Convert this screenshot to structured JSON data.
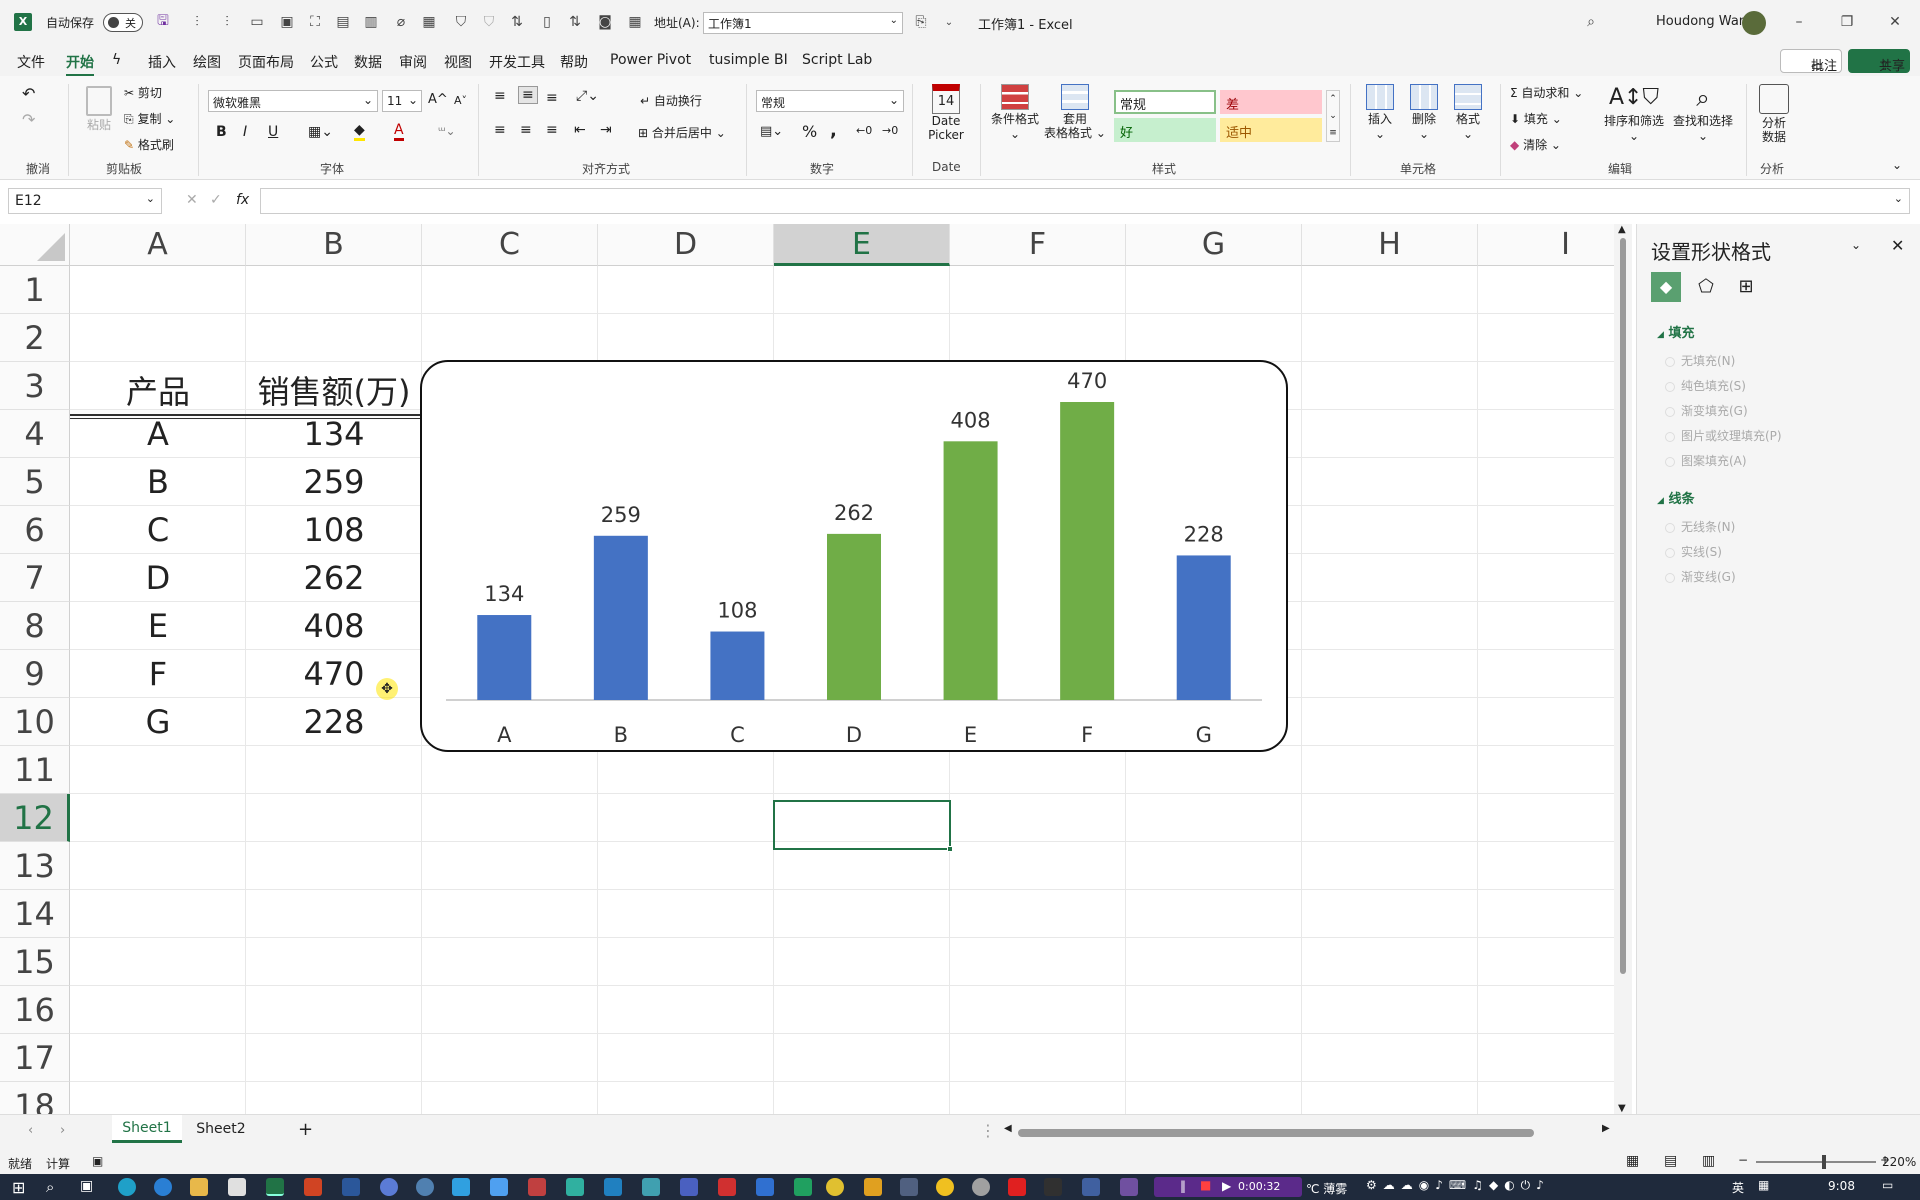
{
  "titlebar": {
    "autosave_label": "自动保存",
    "autosave_state": "关",
    "address_label": "地址(A):",
    "address_value": "工作簿1",
    "title": "工作簿1 - Excel",
    "user": "Houdong Wang"
  },
  "menu": {
    "items": [
      "文件",
      "开始",
      "插入",
      "绘图",
      "页面布局",
      "公式",
      "数据",
      "审阅",
      "视图",
      "开发工具",
      "帮助",
      "Power Pivot",
      "tusimple BI",
      "Script Lab"
    ],
    "comment_btn": "批注",
    "share_btn": "共享"
  },
  "ribbon": {
    "undo": "撤消",
    "paste": "粘贴",
    "cut": "剪切",
    "copy": "复制",
    "format_painter": "格式刷",
    "clipboard": "剪贴板",
    "font_name": "微软雅黑",
    "font_size": "11",
    "bold": "B",
    "italic": "I",
    "underline": "U",
    "font_group": "字体",
    "wrap": "自动换行",
    "merge": "合并后居中",
    "align_group": "对齐方式",
    "num_format": "常规",
    "percent": "%",
    "comma": ",",
    "number_group": "数字",
    "date_picker": "Date Picker",
    "date_group": "Date",
    "date_icon": "14",
    "cond_format": "条件格式",
    "table_format1": "套用",
    "table_format2": "表格格式",
    "style_normal": "常规",
    "style_bad": "差",
    "style_good": "好",
    "style_neutral": "适中",
    "style_group": "样式",
    "insert": "插入",
    "delete": "删除",
    "format": "格式",
    "cells_group": "单元格",
    "autosum": "自动求和",
    "fill": "填充",
    "clear": "清除",
    "sort_filter": "排序和筛选",
    "find_select": "查找和选择",
    "edit_group": "编辑",
    "analyze1": "分析",
    "analyze2": "数据",
    "analyze_group": "分析"
  },
  "formula_bar": {
    "name_box": "E12",
    "fx": "fx",
    "formula": ""
  },
  "sheet": {
    "columns": [
      "A",
      "B",
      "C",
      "D",
      "E",
      "F",
      "G",
      "H",
      "I"
    ],
    "rows": [
      "1",
      "2",
      "3",
      "4",
      "5",
      "6",
      "7",
      "8",
      "9",
      "10",
      "11",
      "12",
      "13",
      "14",
      "15",
      "16",
      "17",
      "18"
    ],
    "header_product": "产品",
    "header_sales": "销售额(万)",
    "data": [
      {
        "p": "A",
        "v": "134"
      },
      {
        "p": "B",
        "v": "259"
      },
      {
        "p": "C",
        "v": "108"
      },
      {
        "p": "D",
        "v": "262"
      },
      {
        "p": "E",
        "v": "408"
      },
      {
        "p": "F",
        "v": "470"
      },
      {
        "p": "G",
        "v": "228"
      }
    ],
    "selected_cell": "E12"
  },
  "chart_data": {
    "type": "bar",
    "categories": [
      "A",
      "B",
      "C",
      "D",
      "E",
      "F",
      "G"
    ],
    "values": [
      134,
      259,
      108,
      262,
      408,
      470,
      228
    ],
    "title": "",
    "xlabel": "",
    "ylabel": "",
    "ylim": [
      0,
      470
    ],
    "data_labels": true,
    "grid": false,
    "legend": "none",
    "colors": {
      "below_avg": "#4472c4",
      "above_avg": "#70ad47"
    },
    "bar_colors": [
      "#4472c4",
      "#4472c4",
      "#4472c4",
      "#70ad47",
      "#70ad47",
      "#70ad47",
      "#4472c4"
    ]
  },
  "pane": {
    "title": "设置形状格式",
    "fill_section": "填充",
    "fill_options": [
      "无填充(N)",
      "纯色填充(S)",
      "渐变填充(G)",
      "图片或纹理填充(P)",
      "图案填充(A)"
    ],
    "line_section": "线条",
    "line_options": [
      "无线条(N)",
      "实线(S)",
      "渐变线(G)"
    ]
  },
  "sheets": {
    "tabs": [
      "Sheet1",
      "Sheet2"
    ],
    "add": "+"
  },
  "status": {
    "ready": "就绪",
    "calc": "计算",
    "zoom": "220%"
  },
  "taskbar": {
    "timer": "0:00:32",
    "weather": "℃ 薄雾",
    "ime": "英",
    "time": "9:08"
  },
  "colors": {
    "excel_green": "#217346",
    "bar_blue": "#4472c4",
    "bar_green": "#70ad47"
  }
}
